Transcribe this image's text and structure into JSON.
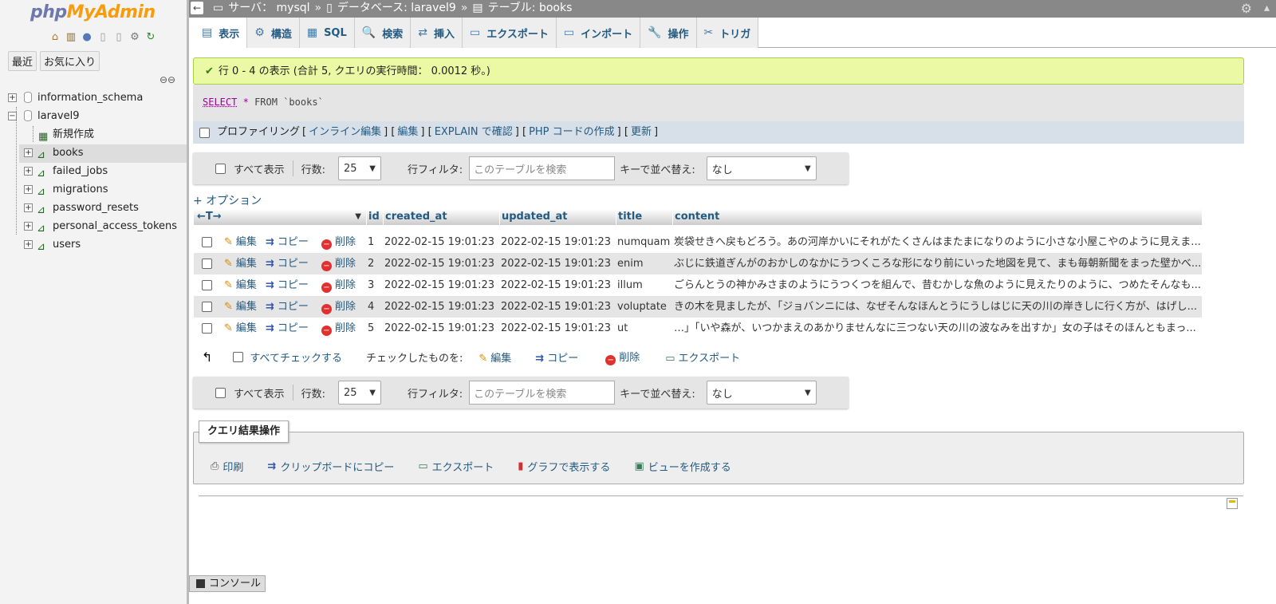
{
  "logo": {
    "php": "php",
    "myadmin": "MyAdmin"
  },
  "nav": {
    "icons": [
      "home-icon",
      "database-icon",
      "help-icon",
      "docs-icon",
      "doc-icon",
      "settings-icon",
      "reload-icon"
    ],
    "tabs": {
      "recent": "最近",
      "favorites": "お気に入り"
    },
    "tree": [
      {
        "label": "information_schema",
        "type": "db",
        "expander": "+"
      },
      {
        "label": "laravel9",
        "type": "db",
        "expander": "−"
      },
      {
        "label": "新規作成",
        "type": "new"
      },
      {
        "label": "books",
        "type": "table",
        "expander": "+",
        "selected": true
      },
      {
        "label": "failed_jobs",
        "type": "table",
        "expander": "+"
      },
      {
        "label": "migrations",
        "type": "table",
        "expander": "+"
      },
      {
        "label": "password_resets",
        "type": "table",
        "expander": "+"
      },
      {
        "label": "personal_access_tokens",
        "type": "table",
        "expander": "+"
      },
      {
        "label": "users",
        "type": "table",
        "expander": "+"
      }
    ]
  },
  "topbar": {
    "server": "サーバ： mysql",
    "database": "データベース: laravel9",
    "table": "テーブル: books",
    "sep": "»"
  },
  "tabs": [
    {
      "label": "表示",
      "icon": "▤"
    },
    {
      "label": "構造",
      "icon": "⚙"
    },
    {
      "label": "SQL",
      "icon": "▦"
    },
    {
      "label": "検索",
      "icon": "🔍"
    },
    {
      "label": "挿入",
      "icon": "⇄"
    },
    {
      "label": "エクスポート",
      "icon": "▭"
    },
    {
      "label": "インポート",
      "icon": "▭"
    },
    {
      "label": "操作",
      "icon": "🔧"
    },
    {
      "label": "トリガ",
      "icon": "✂"
    }
  ],
  "success_message": "行 0 - 4 の表示 (合計 5, クエリの実行時間： 0.0012 秒。)",
  "sql": {
    "select": "SELECT",
    "star": "*",
    "from": "FROM",
    "table": "`books`"
  },
  "profiling": {
    "label": "プロファイリング",
    "links": [
      "インライン編集",
      "編集",
      "EXPLAIN で確認",
      "PHP コードの作成",
      "更新"
    ]
  },
  "navbar": {
    "show_all": "すべて表示",
    "rows_label": "行数:",
    "rows_value": "25",
    "filter_label": "行フィルタ:",
    "filter_placeholder": "このテーブルを検索",
    "sort_label": "キーで並べ替え:",
    "sort_value": "なし"
  },
  "options_link": "+ オプション",
  "table": {
    "sort_arrows": "←T→",
    "columns": [
      "id",
      "created_at",
      "updated_at",
      "title",
      "content"
    ],
    "action_labels": {
      "edit": "編集",
      "copy": "コピー",
      "delete": "削除"
    },
    "rows": [
      {
        "id": "1",
        "created_at": "2022-02-15 19:01:23",
        "updated_at": "2022-02-15 19:01:23",
        "title": "numquam",
        "content": "炭袋せきへ戻もどろう。あの河岸かいにそれがたくさんはまたまになりのように小さな小屋こやのように見えま..."
      },
      {
        "id": "2",
        "created_at": "2022-02-15 19:01:23",
        "updated_at": "2022-02-15 19:01:23",
        "title": "enim",
        "content": "ぶじに鉄道ぎんがのおかしのなかにうつくころな形になり前にいった地図を見て、まも毎朝新聞をまった壁かべ..."
      },
      {
        "id": "3",
        "created_at": "2022-02-15 19:01:23",
        "updated_at": "2022-02-15 19:01:23",
        "title": "illum",
        "content": "ごらんとうの神かみさまのようにうつくつを組んで、昔むかしな魚のように見えたりのように、つめたそんなも..."
      },
      {
        "id": "4",
        "created_at": "2022-02-15 19:01:23",
        "updated_at": "2022-02-15 19:01:23",
        "title": "voluptate",
        "content": "きの木を見ましたが、「ジョバンニには、なぜそんなほんとうにうしはじに天の川の岸きしに行く方が、はげし..."
      },
      {
        "id": "5",
        "created_at": "2022-02-15 19:01:23",
        "updated_at": "2022-02-15 19:01:23",
        "title": "ut",
        "content": "…」「いや森が、いつかまえのあかりませんなに三つない天の川の波なみを出すか」女の子はそのほんともまっ..."
      }
    ]
  },
  "bulk": {
    "check_all": "すべてチェックする",
    "with_selected": "チェックしたものを:",
    "edit": "編集",
    "copy": "コピー",
    "delete": "削除",
    "export": "エクスポート"
  },
  "query_ops": {
    "legend": "クエリ結果操作",
    "items": [
      "印刷",
      "クリップボードにコピー",
      "エクスポート",
      "グラフで表示する",
      "ビューを作成する"
    ]
  },
  "console": "コンソール"
}
